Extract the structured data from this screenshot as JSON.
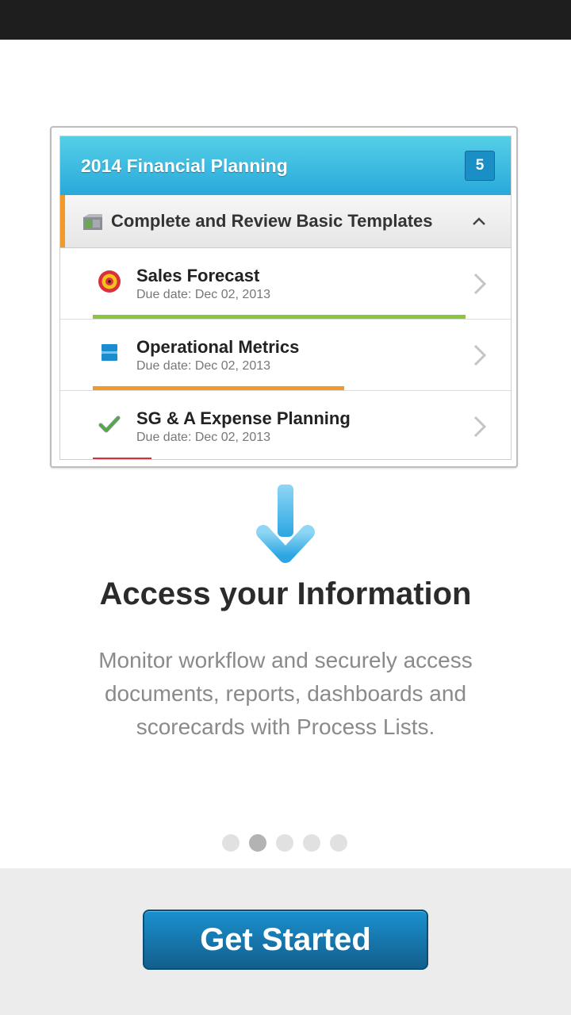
{
  "preview": {
    "header": {
      "title": "2014 Financial Planning",
      "badge_count": "5",
      "color": "#29a9db"
    },
    "section": {
      "label": "Complete and Review Basic Templates",
      "accent_color": "#f09a2c",
      "icon": "folder-icon",
      "caret": "chevron-up-icon"
    },
    "tasks": [
      {
        "name": "Sales Forecast",
        "due": "Due date: Dec 02, 2013",
        "icon": "target-icon",
        "progress": 0.83,
        "progress_color": "#8cc53f"
      },
      {
        "name": "Operational Metrics",
        "due": "Due date: Dec 02, 2013",
        "icon": "stack-icon",
        "progress": 0.56,
        "progress_color": "#f09a2c"
      },
      {
        "name": "SG & A Expense Planning",
        "due": "Due date: Dec 02, 2013",
        "icon": "checkmark-icon",
        "progress": 0.13,
        "progress_color": "#d7323c"
      }
    ]
  },
  "headline": "Access your Information",
  "description": "Monitor workflow and securely access documents, reports, dashboards and scorecards with Process Lists.",
  "pager": {
    "count": 5,
    "active_index": 1
  },
  "cta": {
    "label": "Get Started",
    "color": "#1a82be"
  }
}
